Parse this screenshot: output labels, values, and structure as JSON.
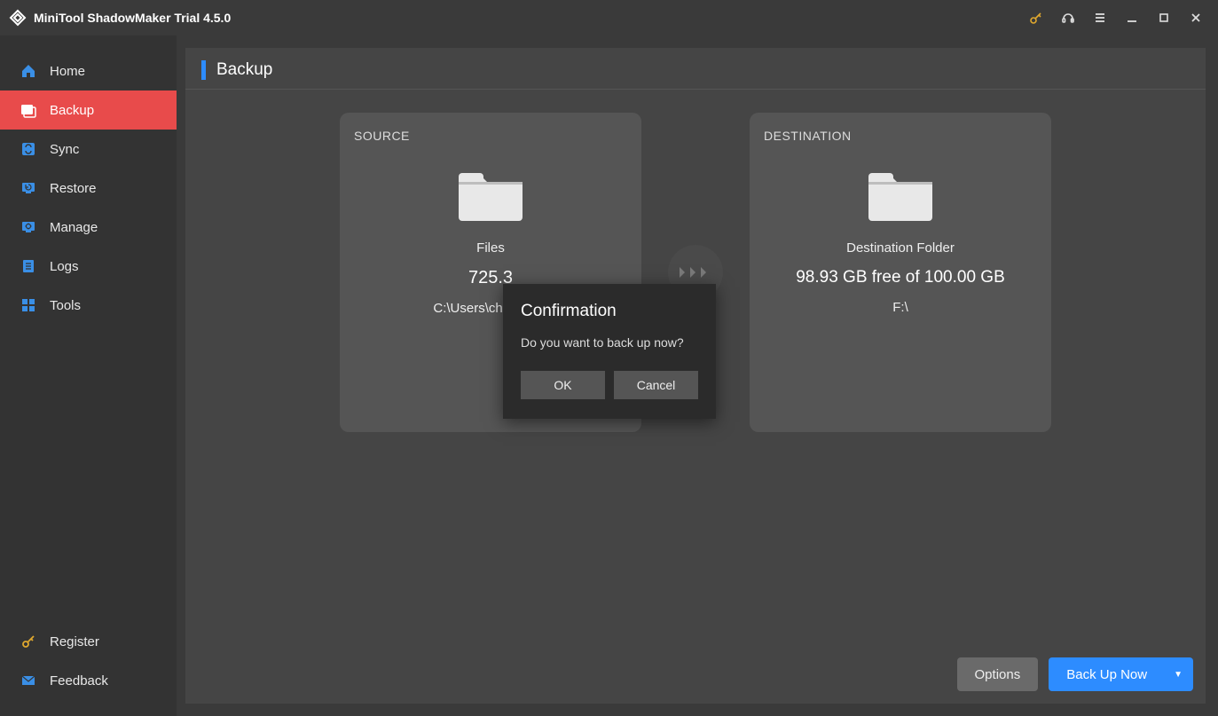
{
  "titlebar": {
    "title": "MiniTool ShadowMaker Trial 4.5.0"
  },
  "sidebar": {
    "items": [
      {
        "label": "Home"
      },
      {
        "label": "Backup"
      },
      {
        "label": "Sync"
      },
      {
        "label": "Restore"
      },
      {
        "label": "Manage"
      },
      {
        "label": "Logs"
      },
      {
        "label": "Tools"
      }
    ],
    "bottom": [
      {
        "label": "Register"
      },
      {
        "label": "Feedback"
      }
    ]
  },
  "page": {
    "title": "Backup"
  },
  "source": {
    "heading": "SOURCE",
    "type": "Files",
    "size_partial": "725.3",
    "path_partial": "C:\\Users\\charl\\Dow"
  },
  "destination": {
    "heading": "DESTINATION",
    "type": "Destination Folder",
    "space": "98.93 GB free of 100.00 GB",
    "path": "F:\\"
  },
  "buttons": {
    "options": "Options",
    "backup_now": "Back Up Now"
  },
  "dialog": {
    "title": "Confirmation",
    "message": "Do you want to back up now?",
    "ok": "OK",
    "cancel": "Cancel"
  }
}
